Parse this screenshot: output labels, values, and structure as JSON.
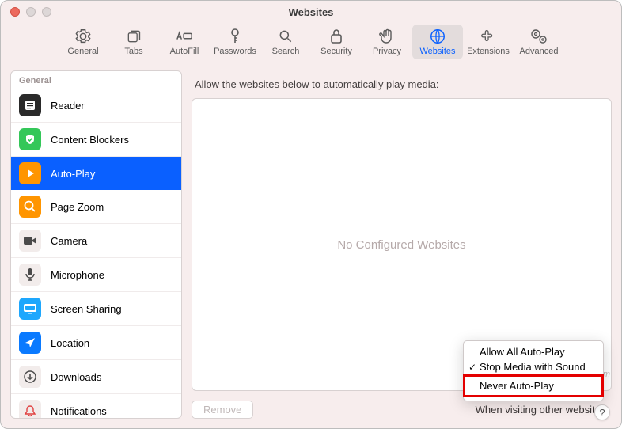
{
  "window": {
    "title": "Websites"
  },
  "toolbar": {
    "items": [
      {
        "label": "General"
      },
      {
        "label": "Tabs"
      },
      {
        "label": "AutoFill"
      },
      {
        "label": "Passwords"
      },
      {
        "label": "Search"
      },
      {
        "label": "Security"
      },
      {
        "label": "Privacy"
      },
      {
        "label": "Websites"
      },
      {
        "label": "Extensions"
      },
      {
        "label": "Advanced"
      }
    ]
  },
  "sidebar": {
    "header": "General",
    "items": [
      {
        "label": "Reader"
      },
      {
        "label": "Content Blockers"
      },
      {
        "label": "Auto-Play"
      },
      {
        "label": "Page Zoom"
      },
      {
        "label": "Camera"
      },
      {
        "label": "Microphone"
      },
      {
        "label": "Screen Sharing"
      },
      {
        "label": "Location"
      },
      {
        "label": "Downloads"
      },
      {
        "label": "Notifications"
      }
    ]
  },
  "main": {
    "allow_label": "Allow the websites below to automatically play media:",
    "empty_text": "No Configured Websites",
    "remove_label": "Remove",
    "policy_label": "When visiting other websites:",
    "menu": {
      "items": [
        {
          "label": "Allow All Auto-Play",
          "checked": false
        },
        {
          "label": "Stop Media with Sound",
          "checked": true
        },
        {
          "label": "Never Auto-Play",
          "checked": false
        }
      ]
    }
  },
  "help": {
    "label": "?"
  },
  "watermark": "www.deuaq.com"
}
